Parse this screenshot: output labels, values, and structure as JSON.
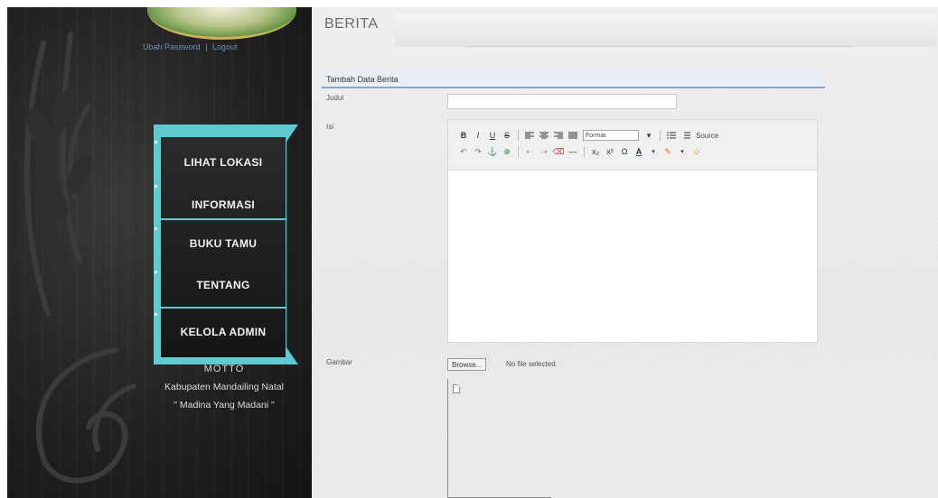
{
  "sidebar": {
    "user_links": {
      "profile": "Ubah Password",
      "separator": "|",
      "logout": "Logout"
    },
    "menu": [
      {
        "label": "LIHAT LOKASI"
      },
      {
        "label": "INFORMASI"
      },
      {
        "label": "BUKU TAMU"
      },
      {
        "label": "TENTANG"
      },
      {
        "label": "KELOLA ADMIN"
      }
    ],
    "motto": {
      "head": "MOTTO",
      "line1": "Kabupaten Mandailing Natal",
      "line2": "\" Madina Yang Madani \""
    }
  },
  "main": {
    "page_title": "BERITA",
    "form_title": "Tambah Data Berita",
    "fields": {
      "title_label": "Judul",
      "title_value": "",
      "content_label": "Isi",
      "image_label": "Gambar"
    },
    "editor": {
      "format_select": "Format",
      "source_label": "Source"
    },
    "file_input": {
      "button": "Browse...",
      "status": "No file selected."
    }
  }
}
